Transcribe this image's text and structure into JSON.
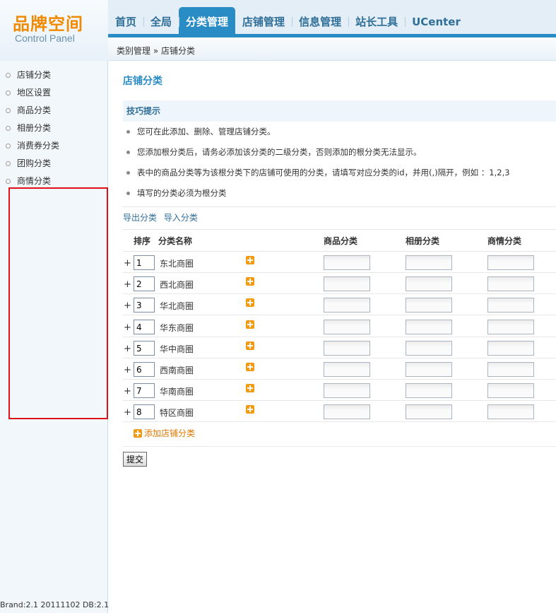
{
  "logo": {
    "title": "品牌空间",
    "subtitle": "Control Panel"
  },
  "nav": [
    {
      "label": "首页"
    },
    {
      "label": "全局"
    },
    {
      "label": "分类管理",
      "active": true
    },
    {
      "label": "店铺管理"
    },
    {
      "label": "信息管理"
    },
    {
      "label": "站长工具"
    },
    {
      "label": "UCenter"
    }
  ],
  "breadcrumb": "类别管理 » 店铺分类",
  "sidebar": {
    "items": [
      {
        "label": "店铺分类"
      },
      {
        "label": "地区设置"
      },
      {
        "label": "商品分类"
      },
      {
        "label": "相册分类"
      },
      {
        "label": "消费券分类"
      },
      {
        "label": "团购分类"
      },
      {
        "label": "商情分类"
      }
    ],
    "version": "Brand:2.1 20111102 DB:2.1"
  },
  "main": {
    "title": "店铺分类",
    "tips_title": "技巧提示",
    "tips": [
      "您可在此添加、删除、管理店铺分类。",
      "您添加根分类后，请务必添加该分类的二级分类，否则添加的根分类无法显示。",
      "表中的商品分类等为该根分类下的店铺可使用的分类，请填写对应分类的id，并用(,)隔开，例如 ：1,2,3",
      "填写的分类必须为根分类"
    ],
    "export_label": "导出分类",
    "import_label": "导入分类",
    "headers": {
      "order": "排序",
      "name": "分类名称",
      "goods": "商品分类",
      "album": "相册分类",
      "business": "商情分类"
    },
    "rows": [
      {
        "order": "1",
        "name": "东北商圈",
        "goods": "",
        "album": "",
        "business": ""
      },
      {
        "order": "2",
        "name": "西北商圈",
        "goods": "",
        "album": "",
        "business": ""
      },
      {
        "order": "3",
        "name": "华北商圈",
        "goods": "",
        "album": "",
        "business": ""
      },
      {
        "order": "4",
        "name": "华东商圈",
        "goods": "",
        "album": "",
        "business": ""
      },
      {
        "order": "5",
        "name": "华中商圈",
        "goods": "",
        "album": "",
        "business": ""
      },
      {
        "order": "6",
        "name": "西南商圈",
        "goods": "",
        "album": "",
        "business": ""
      },
      {
        "order": "7",
        "name": "华南商圈",
        "goods": "",
        "album": "",
        "business": ""
      },
      {
        "order": "8",
        "name": "特区商圈",
        "goods": "",
        "album": "",
        "business": ""
      }
    ],
    "expand_glyph": "+",
    "add_category_label": "添加店铺分类",
    "submit_label": "提交"
  },
  "colors": {
    "accent": "#2a8cc4",
    "logo": "#f08a00",
    "highlight_box": "#e0101a",
    "add_icon": "#f39a11"
  }
}
